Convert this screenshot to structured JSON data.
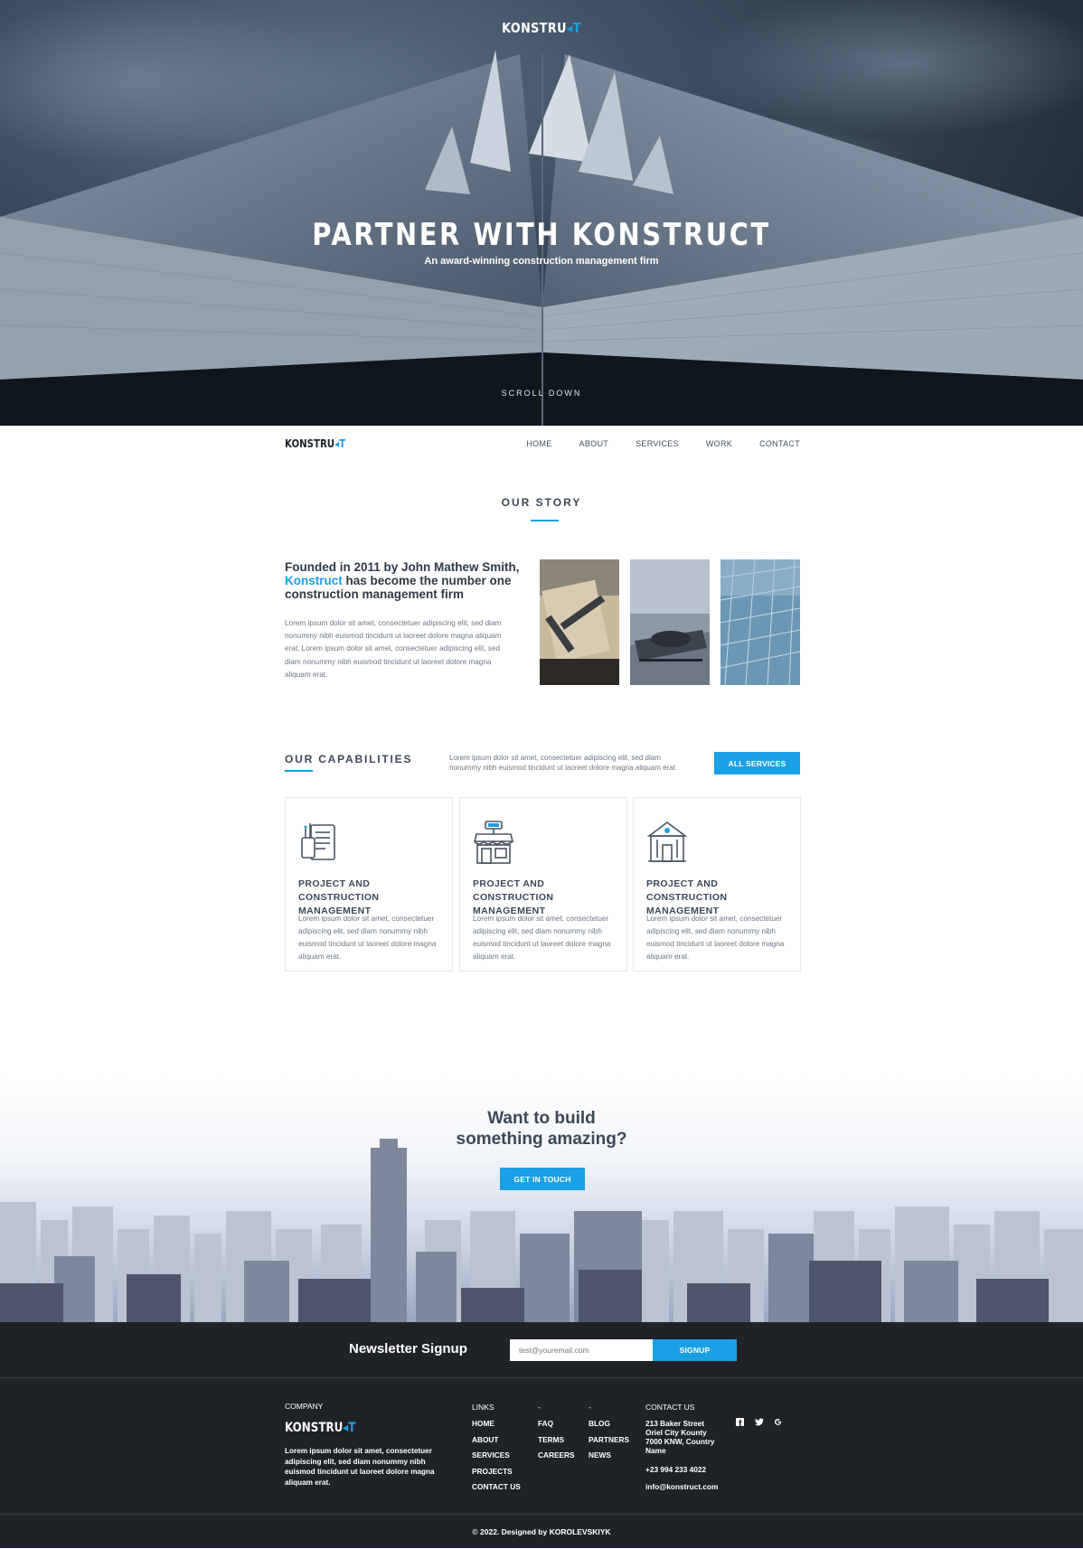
{
  "brand": {
    "logo_text": "KONSTRU",
    "logo_mark": "◂T",
    "accent_color": "#1aa0e4"
  },
  "hero": {
    "title": "PARTNER WITH KONSTRUCT",
    "subtitle": "An award-winning construction management firm",
    "scroll_label": "SCROLL DOWN"
  },
  "nav": {
    "items": [
      "HOME",
      "ABOUT",
      "SERVICES",
      "WORK",
      "CONTACT"
    ]
  },
  "story": {
    "heading": "OUR STORY",
    "title_part1": "Founded in 2011 by John Mathew Smith,",
    "title_highlight": "Konstruct",
    "title_part2": " has become the number one construction management firm",
    "body": "Lorem ipsum dolor sit amet, consectetuer adipiscing elit, sed diam nonummy nibh euismod tincidunt ut laoreet dolore magna aliquam erat. Lorem ipsum dolor sit amet, consectetuer adipiscing elit, sed diam nonummy nibh euismod tincidunt ut laoreet dolore magna aliquam erat.",
    "images": [
      "drafting-tools-photo",
      "laptop-typing-photo",
      "glass-facade-photo"
    ]
  },
  "capabilities": {
    "heading": "OUR CAPABILITIES",
    "description": "Lorem ipsum dolor sit amet, consectetuer adipiscing elit, sed diam nonummy nibh euismod tincidunt ut laoreet dolore magna aliquam erat.",
    "button_label": "ALL SERVICES",
    "cards": [
      {
        "icon": "clipboard-pencils-icon",
        "title": "PROJECT AND CONSTRUCTION MANAGEMENT",
        "body": "Lorem ipsum dolor sit amet, consectetuer adipiscing elit, sed diam nonummy nibh euismod tincidunt ut laoreet dolore magna aliquam erat."
      },
      {
        "icon": "storefront-icon",
        "title": "PROJECT AND CONSTRUCTION MANAGEMENT",
        "body": "Lorem ipsum dolor sit amet, consectetuer adipiscing elit, sed diam nonummy nibh euismod tincidunt ut laoreet dolore magna aliquam erat."
      },
      {
        "icon": "building-icon",
        "title": "PROJECT AND CONSTRUCTION MANAGEMENT",
        "body": "Lorem ipsum dolor sit amet, consectetuer adipiscing elit, sed diam nonummy nibh euismod tincidunt ut laoreet dolore magna aliquam erat."
      }
    ]
  },
  "cta": {
    "title_line1": "Want to build",
    "title_line2": "something amazing?",
    "button_label": "GET IN TOUCH"
  },
  "newsletter": {
    "title": "Newsletter Signup",
    "input_placeholder": "test@youremail.com",
    "button_label": "SIGNUP"
  },
  "footer": {
    "company_heading": "COMPANY",
    "about": "Lorem ipsum dolor sit amet, consectetuer adipiscing elit, sed diam nonummy nibh euismod tincidunt ut laoreet dolore magna aliquam erat.",
    "links_heading": "LINKS",
    "links_col1": [
      "HOME",
      "ABOUT",
      "SERVICES",
      "PROJECTS",
      "CONTACT US"
    ],
    "col2_heading": "-",
    "links_col2": [
      "FAQ",
      "TERMS",
      "CAREERS"
    ],
    "col3_heading": "-",
    "links_col3": [
      "BLOG",
      "PARTNERS",
      "NEWS"
    ],
    "contact_heading": "CONTACT US",
    "address": [
      "213 Baker Street",
      "Oriel City Kounty",
      "7000 KNW, Country",
      "Name"
    ],
    "phone": "+23 994 233 4022",
    "email": "info@konstruct.com",
    "social": [
      "facebook-icon",
      "twitter-icon",
      "google-icon"
    ],
    "copyright": "© 2022. Designed by KOROLEVSKIYK"
  }
}
